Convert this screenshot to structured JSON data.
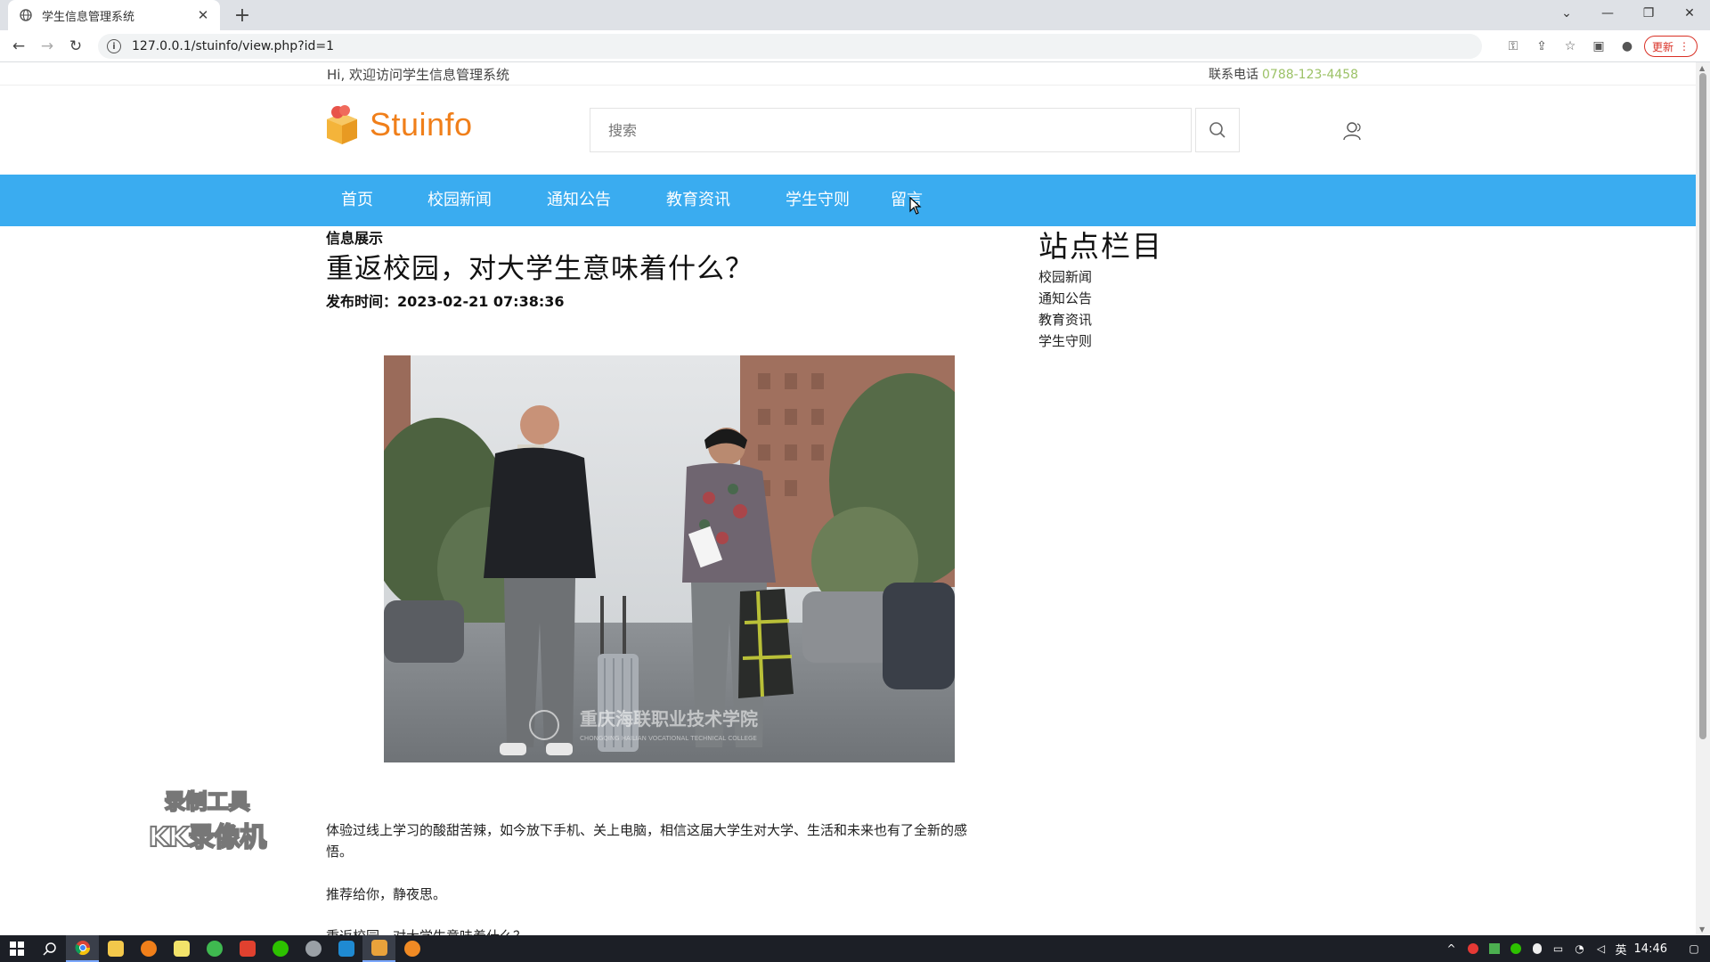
{
  "browser": {
    "tab_title": "学生信息管理系统",
    "tab_close": "✕",
    "new_tab": "+",
    "url": "127.0.0.1/stuinfo/view.php?id=1",
    "update_label": "更新"
  },
  "site": {
    "welcome": "Hi, 欢迎访问学生信息管理系统",
    "phone_label": "联系电话",
    "phone_number": "0788-123-4458",
    "logo_text": "Stuinfo",
    "search_placeholder": "搜索",
    "nav": [
      "首页",
      "校园新闻",
      "通知公告",
      "教育资讯",
      "学生守则",
      "留言"
    ]
  },
  "article": {
    "breadcrumb": "信息展示",
    "title": "重返校园，对大学生意味着什么？",
    "pub_time": "发布时间：2023-02-21 07:38:36",
    "photo_caption": "重庆海联职业技术学院",
    "photo_caption_en": "CHONGQING HAILIAN VOCATIONAL TECHNICAL COLLEGE",
    "paragraphs": [
      "体验过线上学习的酸甜苦辣，如今放下手机、关上电脑，相信这届大学生对大学、生活和未来也有了全新的感",
      "悟。",
      "推荐给你，静夜思。",
      "重返校园，对大学生意味着什么？"
    ]
  },
  "sidebar": {
    "title": "站点栏目",
    "links": [
      "校园新闻",
      "通知公告",
      "教育资讯",
      "学生守则"
    ]
  },
  "watermark": {
    "line1": "录制工具",
    "line2": "KK录像机"
  },
  "taskbar": {
    "ime": "英",
    "time": "14:46"
  },
  "colors": {
    "nav_bg": "#3aacf0",
    "logo": "#f07f1a",
    "phone_number": "#9cc267"
  }
}
